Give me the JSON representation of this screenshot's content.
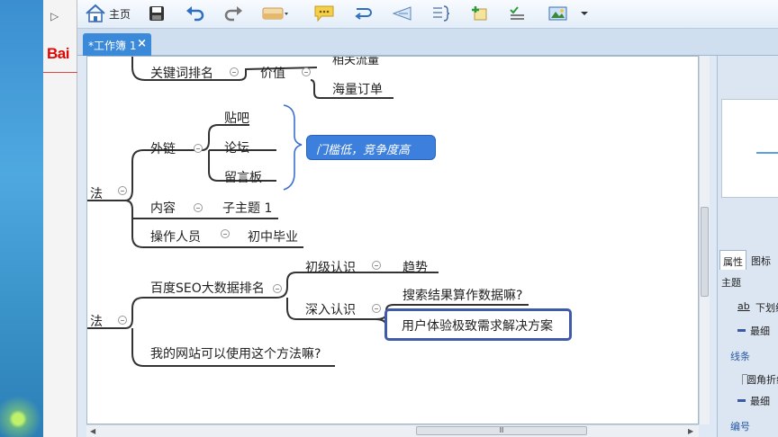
{
  "browser": {
    "collapse_glyph": "▷",
    "logo_text": "Bai"
  },
  "toolbar": {
    "home_label": "主页",
    "icons": [
      "home-icon",
      "save-icon",
      "undo-icon",
      "redo-icon",
      "topic-icon",
      "callout-icon",
      "relationship-icon",
      "boundary-icon",
      "summary-icon",
      "marker-icon",
      "task-icon",
      "image-icon"
    ]
  },
  "tab": {
    "label": "*工作簿 1",
    "close_glyph": "×"
  },
  "mindmap": {
    "nodes": {
      "truncated_top": "相关流量",
      "keyword_ranking": "关键词排名",
      "value": "价值",
      "massive_orders": "海量订单",
      "method_upper": "法",
      "external_links": "外链",
      "tieba": "贴吧",
      "forum": "论坛",
      "guestbook": "留言板",
      "content": "内容",
      "subtopic": "子主题 1",
      "operator": "操作人员",
      "junior_high": "初中毕业",
      "method_lower": "法",
      "baidu_seo": "百度SEO大数据排名",
      "basic_understanding": "初级认识",
      "trend": "趋势",
      "deep_understanding": "深入认识",
      "search_results_question": "搜索结果算作数据嘛?",
      "user_experience": "用户体验极致需求解决方案",
      "can_my_site": "我的网站可以使用这个方法嘛?"
    },
    "callout": "门槛低，竞争度高"
  },
  "right_panel": {
    "tab_properties": "属性",
    "tab_icons": "图标",
    "section_topic": "主题",
    "underline_option": "下划线",
    "weight_thinnest": "最细",
    "section_lines": "线条",
    "line_style": "圆角折线",
    "line_weight": "最细",
    "section_numbering": "编号"
  },
  "scrollbar": {
    "thumb_grip": "Ⅲ"
  },
  "colors": {
    "accent": "#3b8ad9",
    "callout": "#3c7fdc",
    "selection": "#3e5aa8",
    "brace": "#3b6fd0"
  }
}
